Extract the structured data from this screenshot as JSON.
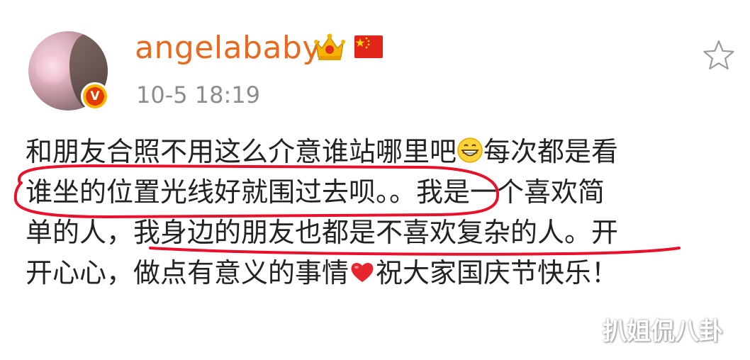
{
  "post": {
    "username": "angelababy",
    "timestamp": "10-5 18:19",
    "verified_badge": "V",
    "crown_icon": "crown-icon",
    "flag_icon": "china-flag-icon",
    "favorite_icon": "star-outline-icon",
    "content_lines": [
      {
        "before": "和朋友合照不用这么介意谁站哪里吧",
        "emoji": "grin-emoji",
        "after": "每次都是看"
      },
      {
        "text": "谁坐的位置光线好就围过去呗。。我是一个喜欢简"
      },
      {
        "text": "单的人，我身边的朋友也都是不喜欢复杂的人。开"
      },
      {
        "before": "开心心，做点有意义的事情",
        "emoji": "heart-emoji",
        "after": "祝大家国庆节快乐！"
      }
    ]
  },
  "watermark": "扒姐侃八卦",
  "colors": {
    "username": "#e86a1e",
    "timestamp": "#8c8c8c",
    "annotation": "#e8102a",
    "verified_outer": "#f7b500",
    "verified_inner": "#e33a00"
  }
}
